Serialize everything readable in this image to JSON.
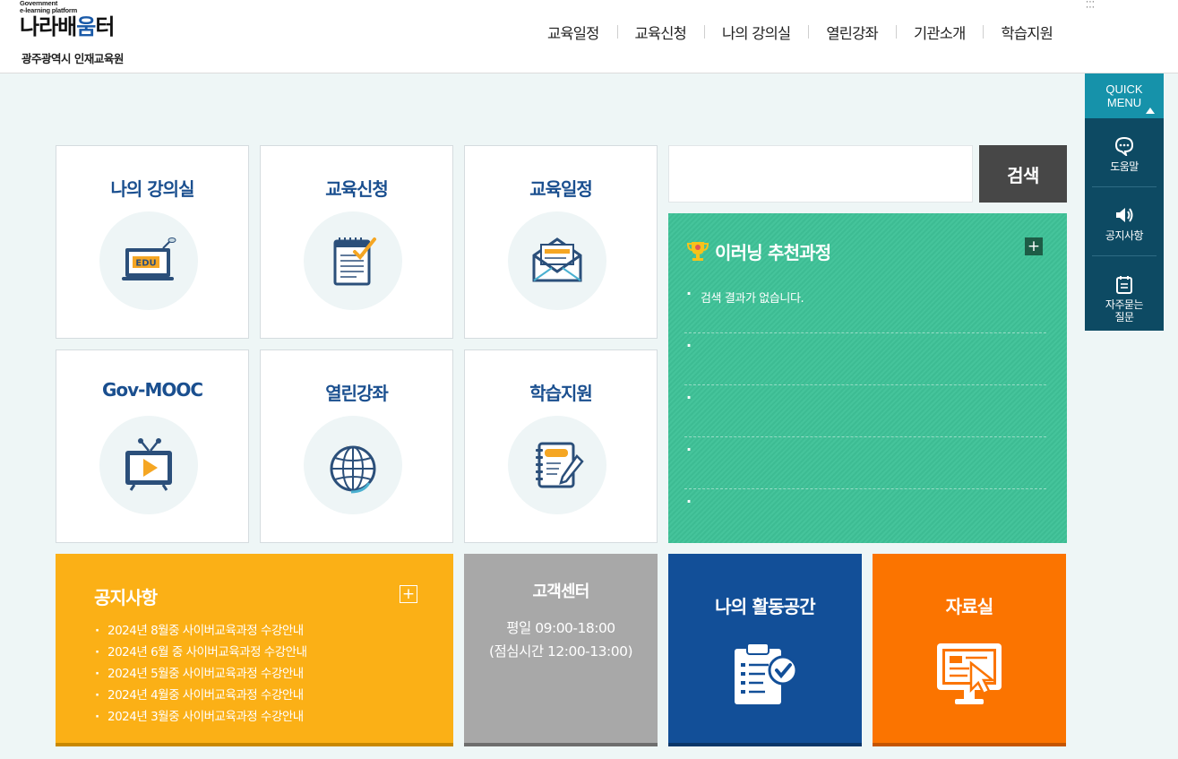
{
  "header": {
    "logo_small_1": "Government",
    "logo_small_2": "e-learning platform",
    "logo_main_1": "나라배",
    "logo_main_2": "움",
    "logo_main_3": "터",
    "org_name": "광주광역시 인재교육원",
    "nav": [
      "교육일정",
      "교육신청",
      "나의 강의실",
      "열린강좌",
      "기관소개",
      "학습지원"
    ]
  },
  "tiles": [
    {
      "title": "나의 강의실",
      "icon": "edu-laptop-icon"
    },
    {
      "title": "교육신청",
      "icon": "notepad-check-icon"
    },
    {
      "title": "교육일정",
      "icon": "envelope-letter-icon"
    },
    {
      "title": "Gov-MOOC",
      "icon": "tv-play-icon"
    },
    {
      "title": "열린강좌",
      "icon": "globe-icon"
    },
    {
      "title": "학습지원",
      "icon": "notebook-pen-icon"
    }
  ],
  "search": {
    "placeholder": "",
    "button": "검색"
  },
  "recommend": {
    "title": "이러닝 추천과정",
    "plus": "+",
    "items": [
      "검색 결과가 없습니다.",
      "",
      "",
      "",
      ""
    ]
  },
  "notice": {
    "title": "공지사항",
    "plus": "+",
    "items": [
      "2024년 8월중 사이버교육과정 수강안내",
      "2024년 6월 중 사이버교육과정 수강안내",
      "2024년 5월중 사이버교육과정 수강안내",
      "2024년 4월중 사이버교육과정 수강안내",
      "2024년 3월중 사이버교육과정 수강안내"
    ]
  },
  "customer": {
    "title": "고객센터",
    "hours_1": "평일 09:00-18:00",
    "hours_2": "(점심시간 12:00-13:00)"
  },
  "activity": {
    "title": "나의 활동공간",
    "icon": "clipboard-check-icon"
  },
  "archive": {
    "title": "자료실",
    "icon": "monitor-cursor-icon"
  },
  "quick_menu": {
    "title_1": "QUICK",
    "title_2": "MENU",
    "items": [
      {
        "label": "도움말",
        "icon": "chat-bubble-icon"
      },
      {
        "label": "공지사항",
        "icon": "speaker-icon"
      },
      {
        "label_1": "자주묻는",
        "label_2": "질문",
        "icon": "faq-note-icon"
      }
    ]
  },
  "colors": {
    "nav_text": "#222222",
    "tile_title": "#1a4f8f",
    "recommend_bg": "#3dbc93",
    "notice_bg": "#fbb016",
    "customer_bg": "#a8a8a8",
    "activity_bg": "#124f98",
    "archive_bg": "#fb7400",
    "quick_head": "#1692aa",
    "quick_body": "#0d4a63",
    "search_btn": "#474747"
  }
}
